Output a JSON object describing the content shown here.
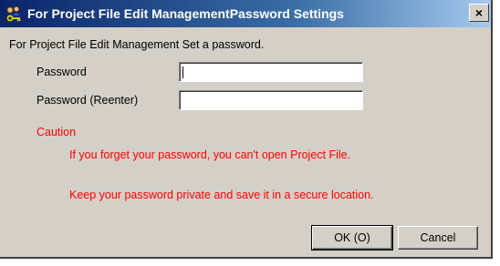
{
  "window": {
    "title": "For Project File Edit ManagementPassword Settings",
    "close_label": "×"
  },
  "instruction": "For Project File Edit Management Set a password.",
  "fields": {
    "password_label": "Password",
    "password_value": "",
    "reenter_label": "Password (Reenter)",
    "reenter_value": ""
  },
  "caution": {
    "heading": "Caution",
    "line1": "If you forget your password, you can't open Project File.",
    "line2": "Keep your password private and save it in a secure location.",
    "color": "#ff0000"
  },
  "buttons": {
    "ok_label": "OK (O)",
    "cancel_label": "Cancel"
  },
  "icons": {
    "title_icon": "key-people-icon"
  }
}
